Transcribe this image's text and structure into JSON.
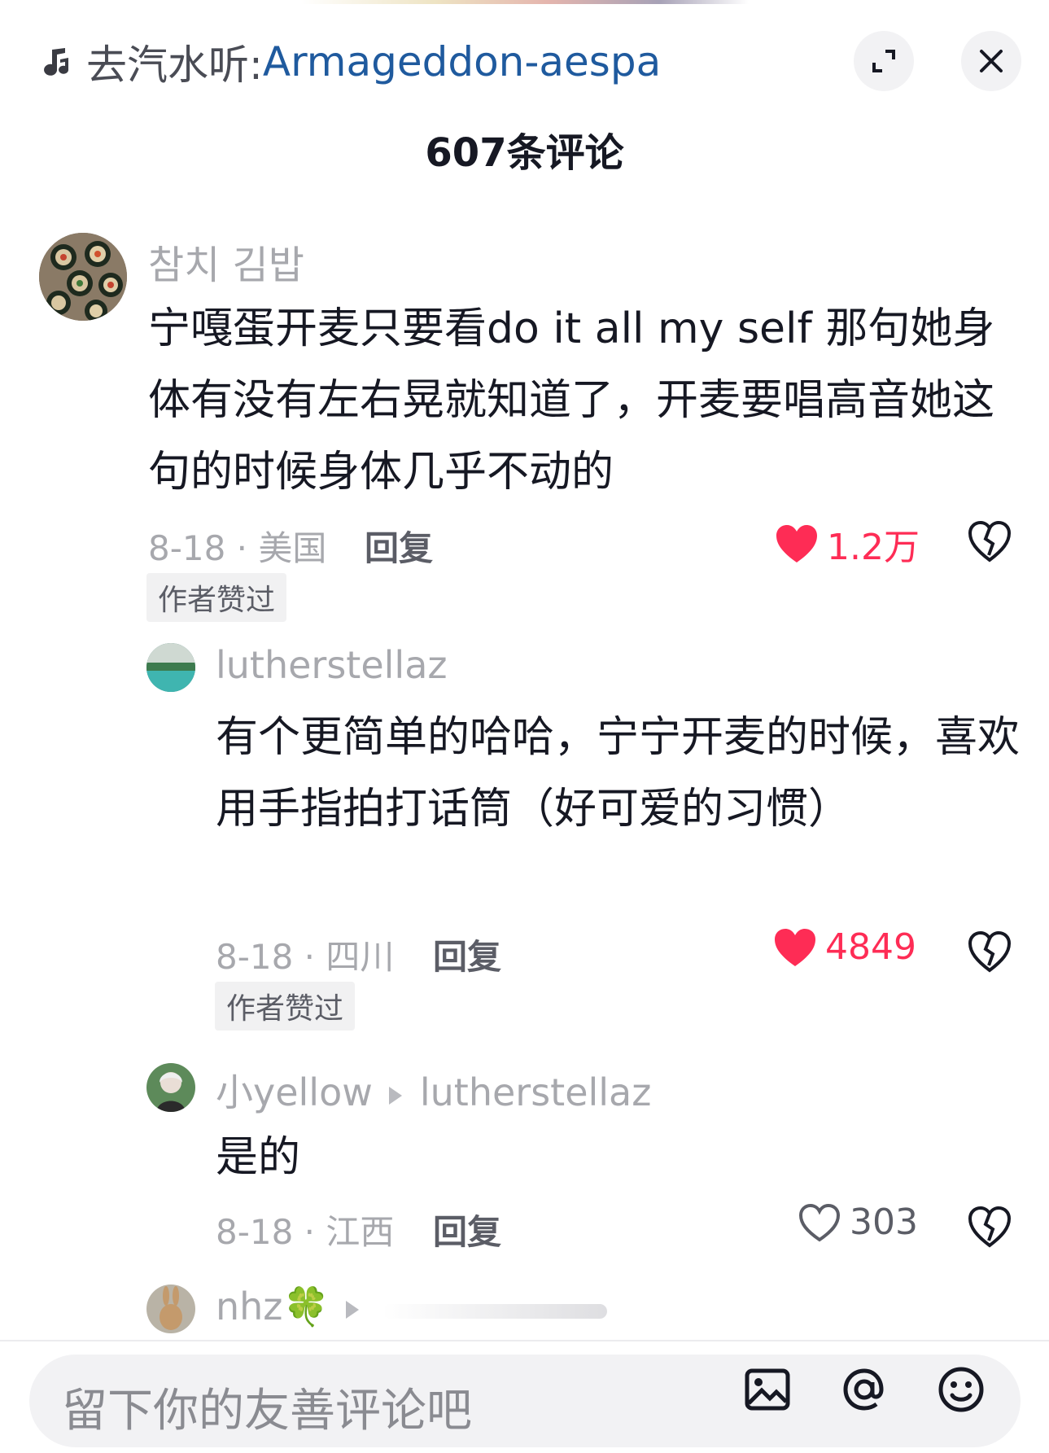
{
  "header": {
    "music_prefix": "去汽水听:",
    "music_title": "Armageddon-aespa",
    "comment_count": "607条评论",
    "icons": {
      "music": "music-note-icon",
      "expand": "expand-icon",
      "close": "close-icon"
    }
  },
  "comments": [
    {
      "username": "참치 김밥",
      "text": "宁嘎蛋开麦只要看do it all my self 那句她身体有没有左右晃就知道了，开麦要唱高音她这句的时候身体几乎不动的",
      "date": "8-18",
      "location": "美国",
      "reply_label": "回复",
      "badge": "作者赞过",
      "likes": "1.2万",
      "liked": true
    },
    {
      "username": "lutherstellaz",
      "text": "有个更简单的哈哈，宁宁开麦的时候，喜欢用手指拍打话筒（好可爱的习惯）",
      "date": "8-18",
      "location": "四川",
      "reply_label": "回复",
      "badge": "作者赞过",
      "likes": "4849",
      "liked": true
    },
    {
      "username": "小yellow",
      "reply_to": "lutherstellaz",
      "text": "是的",
      "date": "8-18",
      "location": "江西",
      "reply_label": "回复",
      "likes": "303",
      "liked": false
    },
    {
      "username": "nhz🍀"
    }
  ],
  "composer": {
    "placeholder": "留下你的友善评论吧",
    "icons": [
      "image-icon",
      "at-icon",
      "emoji-icon"
    ]
  },
  "colors": {
    "like_red": "#fe2c55",
    "link_blue": "#1f5a9e",
    "gray_text": "#a7a8ad",
    "body_text": "#161823"
  }
}
